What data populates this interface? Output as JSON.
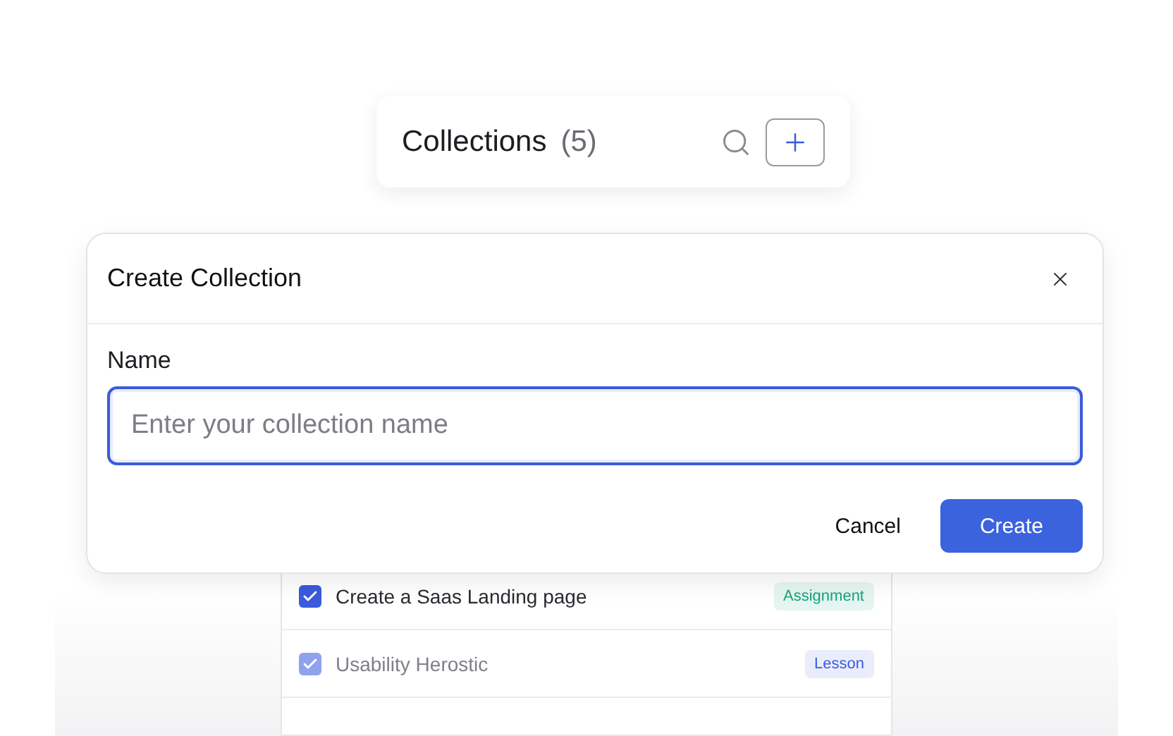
{
  "header": {
    "title": "Collections",
    "count": "(5)"
  },
  "dialog": {
    "title": "Create Collection",
    "field_label": "Name",
    "placeholder": "Enter your collection name",
    "buttons": [
      {
        "label": "Cancel",
        "kind": "secondary"
      },
      {
        "label": "Create",
        "kind": "primary"
      }
    ]
  },
  "list": [
    {
      "title": "Create a Saas Landing page",
      "checked": true,
      "tag": "Assignment",
      "color": "#16a37a"
    },
    {
      "title": "Usability Herostic",
      "checked": true,
      "tag": "Lesson",
      "color": "#3b5bdb"
    }
  ]
}
